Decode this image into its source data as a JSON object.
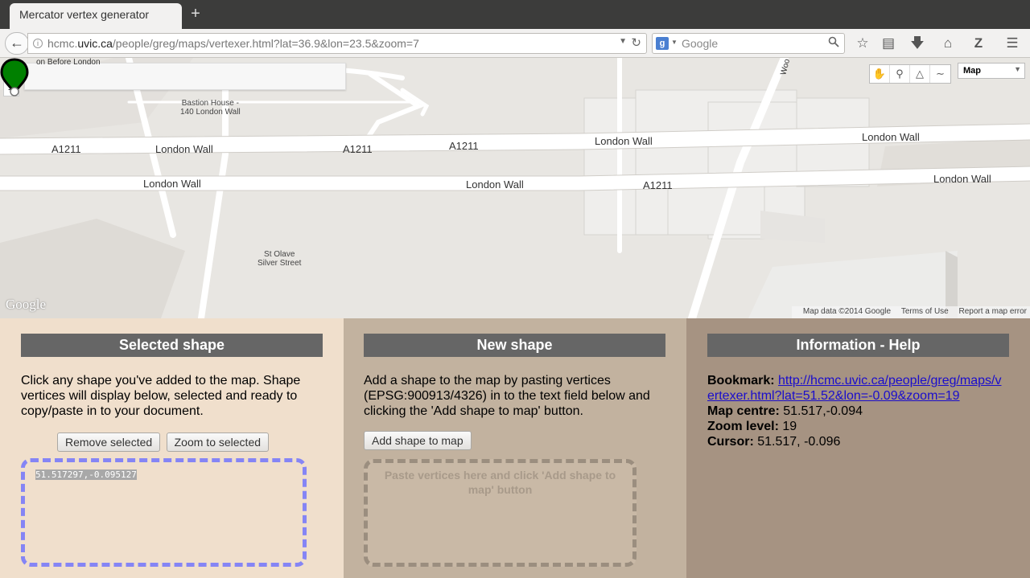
{
  "browser": {
    "tab_title": "Mercator vertex generator",
    "new_tab": "+",
    "url_prefix": "hcmc.",
    "url_host": "uvic.ca",
    "url_path": "/people/greg/maps/vertexer.html?lat=36.9&lon=23.5&zoom=7",
    "search_engine": "g",
    "search_placeholder": "Google"
  },
  "map": {
    "zoom_in": "+",
    "zoom_out": "−",
    "map_type": "Map",
    "google_logo": "Google",
    "footer": [
      "Map data ©2014 Google",
      "Terms of Use",
      "Report a map error"
    ],
    "labels": {
      "before_london": "on Before London",
      "bastion_1": "Bastion House -",
      "bastion_2": "140 London Wall",
      "a1211_1": "A1211",
      "london_wall_1": "London Wall",
      "a1211_2": "A1211",
      "a1211_3": "A1211",
      "london_wall_2": "London Wall",
      "london_wall_3": "London Wall",
      "london_wall_4": "London Wall",
      "london_wall_5": "London Wall",
      "a1211_4": "A1211",
      "london_wall_6": "London Wall",
      "st_olave_1": "St Olave",
      "st_olave_2": "Silver Street",
      "wood": "Woo"
    }
  },
  "selected": {
    "title": "Selected shape",
    "description": "Click any shape you've added to the map. Shape vertices will display below, selected and ready to copy/paste in to your document.",
    "remove_button": "Remove selected",
    "zoom_button": "Zoom to selected",
    "vertices": "51.517297,-0.095127"
  },
  "new_shape": {
    "title": "New shape",
    "description": "Add a shape to the map by pasting vertices (EPSG:900913/4326) in to the text field below and clicking the 'Add shape to map' button.",
    "add_button": "Add shape to map",
    "placeholder": "Paste vertices here and click 'Add shape to map' button"
  },
  "info": {
    "title": "Information - Help",
    "bookmark_label": "Bookmark:",
    "bookmark_url": "http://hcmc.uvic.ca/people/greg/maps/vertexer.html?lat=51.52&lon=-0.09&zoom=19",
    "map_centre_label": "Map centre:",
    "map_centre": "51.517,-0.094",
    "zoom_label": "Zoom level:",
    "zoom": "19",
    "cursor_label": "Cursor:",
    "cursor": "51.517, -0.096"
  },
  "colors": {
    "panel_1": "#f0dfcc",
    "panel_2": "#c2b29f",
    "panel_3": "#a69382",
    "header_bg": "#666666",
    "selected_border": "#8585f5",
    "marker": "#008000"
  }
}
